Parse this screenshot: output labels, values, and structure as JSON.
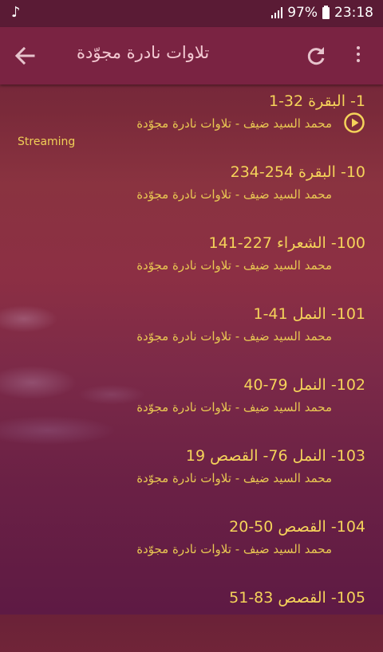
{
  "status_bar": {
    "battery": "97%",
    "time": "23:18",
    "icons": [
      "music-note-icon",
      "signal-icon",
      "battery-icon"
    ]
  },
  "app_bar": {
    "title": "تلاوات نادرة مجوّدة",
    "icons": [
      "back-arrow-icon",
      "refresh-icon",
      "more-vert-icon"
    ]
  },
  "colors": {
    "accent": "#f5d35a",
    "app_bar": "#7a2342",
    "status_bar": "#5a1b35",
    "title_text": "#f3c9d2"
  },
  "tracks": [
    {
      "title": "1- البقرة 32-1",
      "subtitle": "محمد السيد ضيف - تلاوات نادرة مجوّدة",
      "playing": true,
      "status": "Streaming"
    },
    {
      "title": "10- البقرة 254-234",
      "subtitle": "محمد السيد ضيف - تلاوات نادرة مجوّدة"
    },
    {
      "title": "100- الشعراء 227-141",
      "subtitle": "محمد السيد ضيف - تلاوات نادرة مجوّدة"
    },
    {
      "title": "101- النمل 41-1",
      "subtitle": "محمد السيد ضيف - تلاوات نادرة مجوّدة"
    },
    {
      "title": "102- النمل 79-40",
      "subtitle": "محمد السيد ضيف - تلاوات نادرة مجوّدة"
    },
    {
      "title": "103- النمل 76- القصص 19",
      "subtitle": "محمد السيد ضيف - تلاوات نادرة مجوّدة"
    },
    {
      "title": "104- القصص 50-20",
      "subtitle": "محمد السيد ضيف - تلاوات نادرة مجوّدة"
    },
    {
      "title": "105- القصص 83-51",
      "subtitle": ""
    }
  ]
}
